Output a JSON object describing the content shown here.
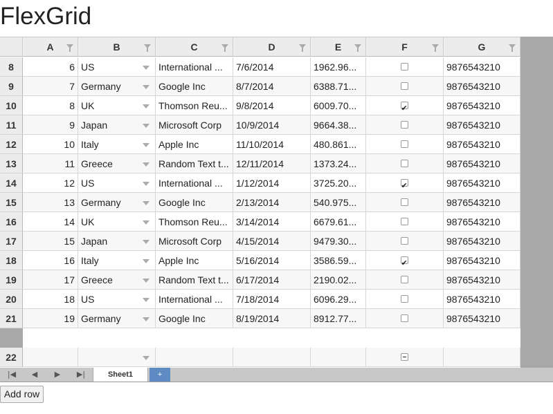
{
  "title": "FlexGrid",
  "columns": [
    {
      "label": "A",
      "filter_icon": "filter-icon"
    },
    {
      "label": "B",
      "filter_icon": "filter-icon"
    },
    {
      "label": "C",
      "filter_icon": "filter-icon"
    },
    {
      "label": "D",
      "filter_icon": "filter-icon"
    },
    {
      "label": "E",
      "filter_icon": "filter-icon"
    },
    {
      "label": "F",
      "filter_icon": "filter-icon"
    },
    {
      "label": "G",
      "filter_icon": "filter-icon"
    }
  ],
  "rows": [
    {
      "num": "8",
      "a": "6",
      "b": "US",
      "c": "International ...",
      "d": "7/6/2014",
      "e": "1962.96...",
      "f": false,
      "g": "9876543210"
    },
    {
      "num": "9",
      "a": "7",
      "b": "Germany",
      "c": "Google Inc",
      "d": "8/7/2014",
      "e": "6388.71...",
      "f": false,
      "g": "9876543210"
    },
    {
      "num": "10",
      "a": "8",
      "b": "UK",
      "c": "Thomson Reu...",
      "d": "9/8/2014",
      "e": "6009.70...",
      "f": true,
      "g": "9876543210"
    },
    {
      "num": "11",
      "a": "9",
      "b": "Japan",
      "c": "Microsoft Corp",
      "d": "10/9/2014",
      "e": "9664.38...",
      "f": false,
      "g": "9876543210"
    },
    {
      "num": "12",
      "a": "10",
      "b": "Italy",
      "c": "Apple Inc",
      "d": "11/10/2014",
      "e": "480.861...",
      "f": false,
      "g": "9876543210"
    },
    {
      "num": "13",
      "a": "11",
      "b": "Greece",
      "c": "Random Text t...",
      "d": "12/11/2014",
      "e": "1373.24...",
      "f": false,
      "g": "9876543210"
    },
    {
      "num": "14",
      "a": "12",
      "b": "US",
      "c": "International ...",
      "d": "1/12/2014",
      "e": "3725.20...",
      "f": true,
      "g": "9876543210"
    },
    {
      "num": "15",
      "a": "13",
      "b": "Germany",
      "c": "Google Inc",
      "d": "2/13/2014",
      "e": "540.975...",
      "f": false,
      "g": "9876543210"
    },
    {
      "num": "16",
      "a": "14",
      "b": "UK",
      "c": "Thomson Reu...",
      "d": "3/14/2014",
      "e": "6679.61...",
      "f": false,
      "g": "9876543210"
    },
    {
      "num": "17",
      "a": "15",
      "b": "Japan",
      "c": "Microsoft Corp",
      "d": "4/15/2014",
      "e": "9479.30...",
      "f": false,
      "g": "9876543210"
    },
    {
      "num": "18",
      "a": "16",
      "b": "Italy",
      "c": "Apple Inc",
      "d": "5/16/2014",
      "e": "3586.59...",
      "f": true,
      "g": "9876543210"
    },
    {
      "num": "19",
      "a": "17",
      "b": "Greece",
      "c": "Random Text t...",
      "d": "6/17/2014",
      "e": "2190.02...",
      "f": false,
      "g": "9876543210"
    },
    {
      "num": "20",
      "a": "18",
      "b": "US",
      "c": "International ...",
      "d": "7/18/2014",
      "e": "6096.29...",
      "f": false,
      "g": "9876543210"
    },
    {
      "num": "21",
      "a": "19",
      "b": "Germany",
      "c": "Google Inc",
      "d": "8/19/2014",
      "e": "8912.77...",
      "f": false,
      "g": "9876543210"
    }
  ],
  "summary_row": {
    "num": "22",
    "f_state": "indeterminate"
  },
  "sheet_tabs": {
    "nav": [
      "first-sheet-icon",
      "prev-sheet-icon",
      "next-sheet-icon",
      "last-sheet-icon"
    ],
    "active": "Sheet1",
    "add_icon": "add-sheet-icon"
  },
  "add_row_button": "Add row"
}
